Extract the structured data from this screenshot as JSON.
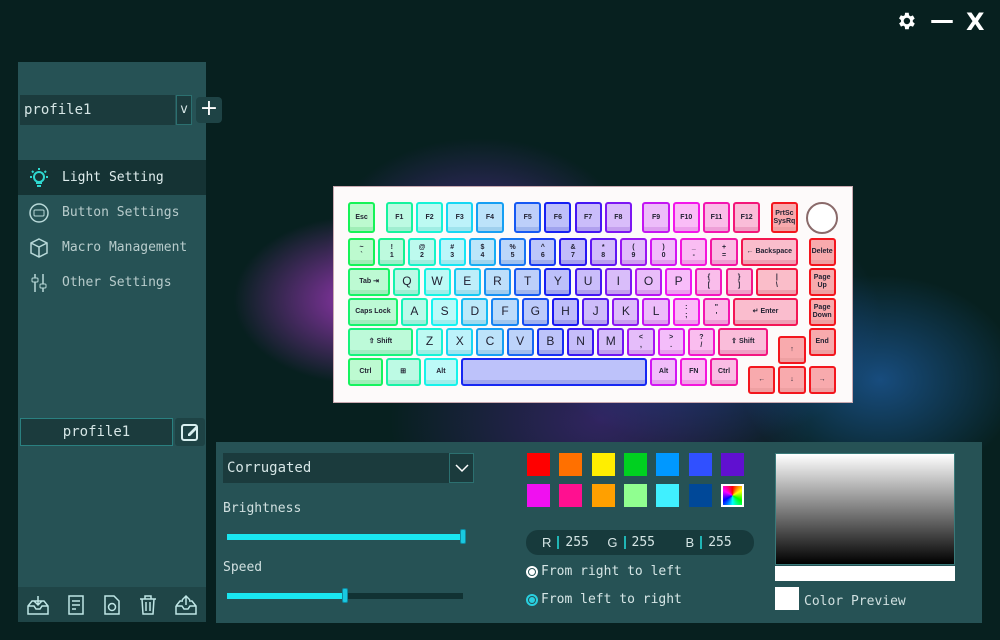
{
  "window": {
    "settings_icon": "gear-icon",
    "minimize_label": "—",
    "close_label": "X"
  },
  "sidebar": {
    "profile_select": {
      "value": "profile1",
      "arrow": "v"
    },
    "add_label": "+",
    "items": [
      {
        "label": "Light Setting",
        "icon": "lightbulb-icon",
        "active": true
      },
      {
        "label": "Button Settings",
        "icon": "buttons-icon"
      },
      {
        "label": "Macro Management",
        "icon": "cube-icon"
      },
      {
        "label": "Other Settings",
        "icon": "sliders-icon"
      }
    ],
    "profile_name": "profile1",
    "bottom_icons": [
      "import-icon",
      "notes-icon",
      "reset-file-icon",
      "trash-icon",
      "export-icon"
    ]
  },
  "keyboard": {
    "rows": [
      [
        "Esc",
        "F1",
        "F2",
        "F3",
        "F4",
        "F5",
        "F6",
        "F7",
        "F8",
        "F9",
        "F10",
        "F11",
        "F12",
        "PrtSc\nSysRq"
      ],
      [
        "~\n`",
        "!\n1",
        "@\n2",
        "#\n3",
        "$\n4",
        "%\n5",
        "^\n6",
        "&\n7",
        "*\n8",
        "(\n9",
        ")\n0",
        "_\n-",
        "+\n=",
        "← Backspace",
        "Delete"
      ],
      [
        "Tab ⇥",
        "Q",
        "W",
        "E",
        "R",
        "T",
        "Y",
        "U",
        "I",
        "O",
        "P",
        "{\n[",
        "}\n]",
        "|\n\\",
        "Page\nUp"
      ],
      [
        "Caps Lock",
        "A",
        "S",
        "D",
        "F",
        "G",
        "H",
        "J",
        "K",
        "L",
        ":\n;",
        "\"\n'",
        "↵ Enter",
        "Page\nDown"
      ],
      [
        "⇧ Shift",
        "Z",
        "X",
        "C",
        "V",
        "B",
        "N",
        "M",
        "<\n,",
        ">\n.",
        "?\n/",
        "⇧ Shift",
        "↑",
        "End"
      ],
      [
        "Ctrl",
        "⊞",
        "Alt",
        "",
        "Alt",
        "FN",
        "Ctrl",
        "←",
        "↓",
        "→"
      ]
    ]
  },
  "effects": {
    "mode": "Corrugated",
    "brightness_label": "Brightness",
    "brightness": 100,
    "speed_label": "Speed",
    "speed": 50,
    "swatches": [
      "#ff0000",
      "#ff7000",
      "#ffee00",
      "#00d020",
      "#0098ff",
      "#3050ff",
      "#6010d0",
      "#f010f0",
      "#ff1090",
      "#ffa000",
      "#90ff90",
      "#40f0ff",
      "#004898",
      "rainbow"
    ],
    "rgb": {
      "r_label": "R",
      "r": "255",
      "g_label": "G",
      "g": "255",
      "b_label": "B",
      "b": "255"
    },
    "directions": [
      {
        "label": "From right to left",
        "selected": false
      },
      {
        "label": "From left to right",
        "selected": true
      }
    ],
    "preview_label": "Color Preview",
    "preview_color": "#ffffff"
  }
}
